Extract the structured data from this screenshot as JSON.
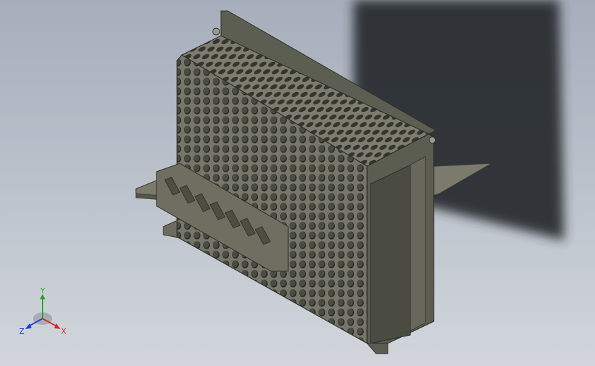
{
  "viewport": {
    "background_top": "#a6aebb",
    "background_bottom": "#d2d6dc"
  },
  "model": {
    "body_color": "#6f705f",
    "shadow_color": "#2a2d33"
  },
  "triad": {
    "y_label": "Y",
    "x_label": "X",
    "z_label": "Z",
    "y_color": "#2ca02c",
    "x_color": "#d62728",
    "z_color": "#1f3fd0"
  }
}
